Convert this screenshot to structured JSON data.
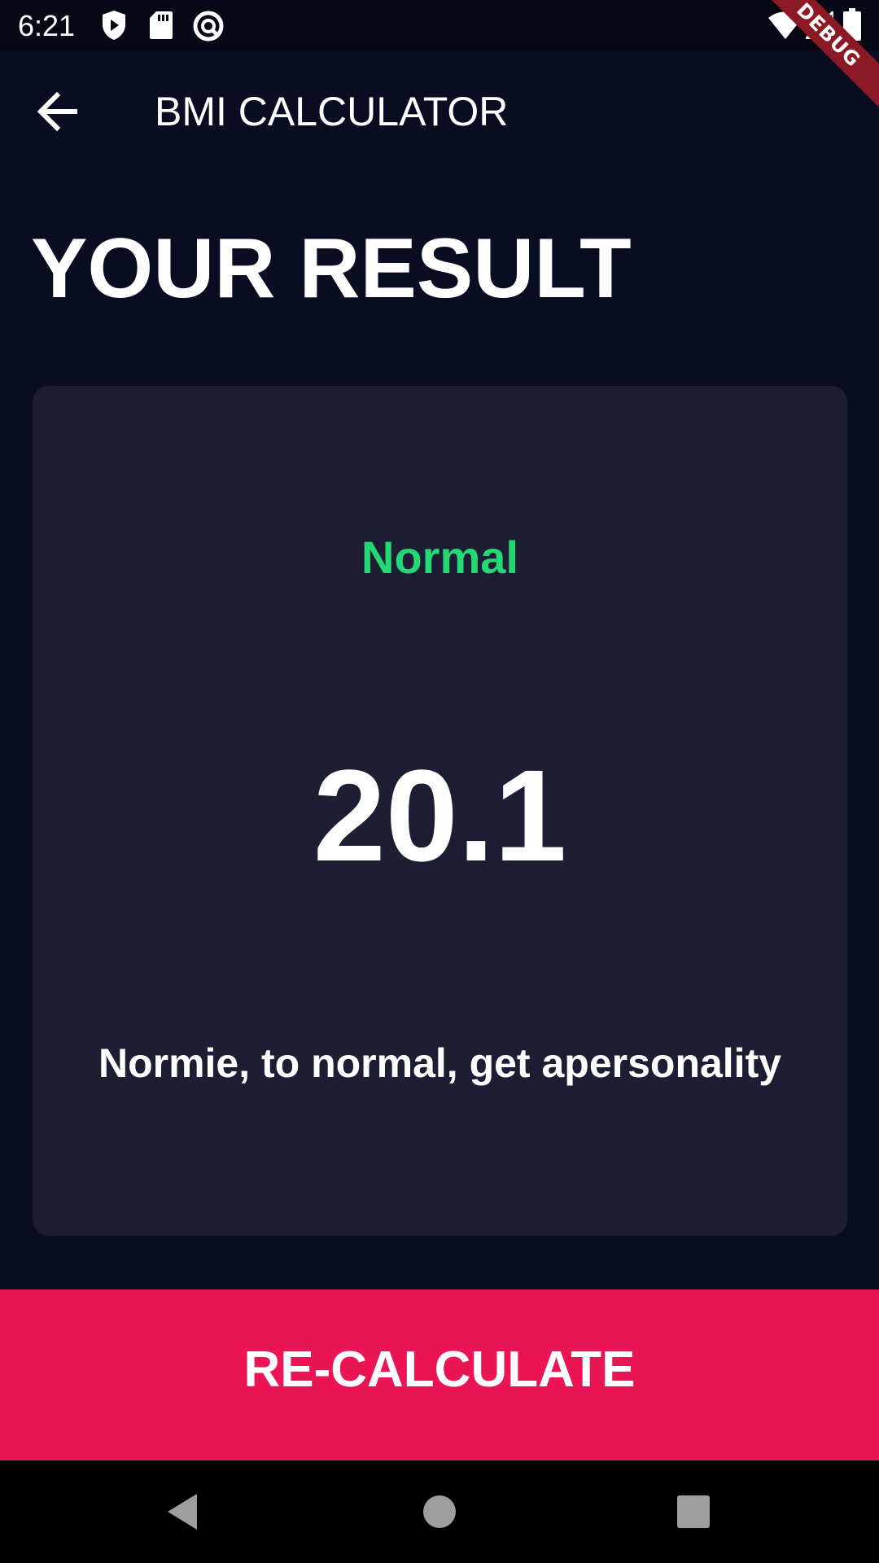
{
  "status_bar": {
    "time": "6:21",
    "icons": [
      "shield-play-icon",
      "sd-card-icon",
      "sync-circle-icon",
      "wifi-icon",
      "signal-icon",
      "battery-icon"
    ]
  },
  "debug_banner": "DEBUG",
  "app_bar": {
    "back_icon": "arrow-back-icon",
    "title": "BMI CALCULATOR"
  },
  "page": {
    "heading": "YOUR RESULT"
  },
  "result": {
    "status": "Normal",
    "value": "20.1",
    "message": "Normie, to normal, get apersonality"
  },
  "recalculate_button": {
    "label": "RE-CALCULATE"
  },
  "nav_bar": {
    "buttons": [
      "back-triangle-icon",
      "home-circle-icon",
      "recents-square-icon"
    ]
  },
  "colors": {
    "background": "#0a0d21",
    "card": "#1d1e33",
    "status_green": "#24d876",
    "accent_pink": "#eb1555"
  }
}
